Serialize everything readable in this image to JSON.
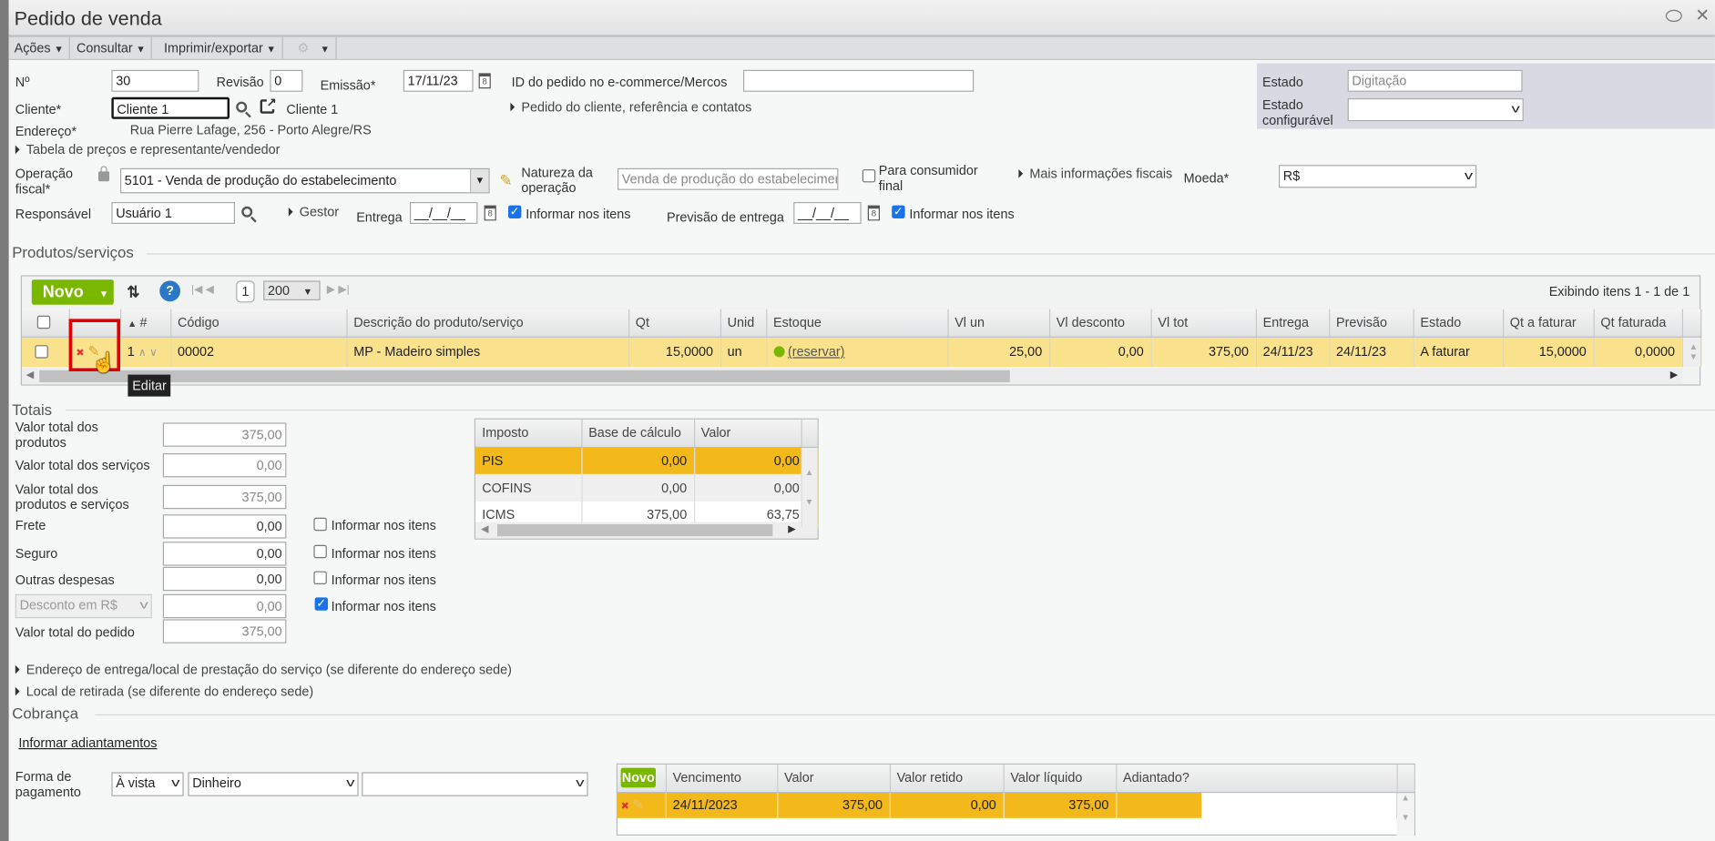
{
  "window": {
    "title": "Pedido de venda"
  },
  "toolbar": {
    "acoes": "Ações",
    "consultar": "Consultar",
    "imprimir": "Imprimir/exportar"
  },
  "header": {
    "numero_label": "Nº",
    "numero": "30",
    "revisao_label": "Revisão",
    "revisao": "0",
    "emissao_label": "Emissão*",
    "emissao": "17/11/23",
    "id_ecommerce_label": "ID do pedido no e-commerce/Mercos",
    "id_ecommerce": "",
    "cliente_label": "Cliente*",
    "cliente": "Cliente 1",
    "cliente_link": "Cliente 1",
    "pedido_cliente_expander": "Pedido do cliente, referência e contatos",
    "endereco_label": "Endereço*",
    "endereco": "Rua Pierre Lafage, 256 - Porto Alegre/RS",
    "tabela_precos_expander": "Tabela de preços e representante/vendedor",
    "operacao_label": "Operação fiscal*",
    "operacao": "5101 - Venda de produção do estabelecimento",
    "natureza_label": "Natureza da operação",
    "natureza": "Venda de produção do estabelecimento",
    "consumidor_final_label": "Para consumidor final",
    "mais_info_fiscais": "Mais informações fiscais",
    "moeda_label": "Moeda*",
    "moeda": "R$",
    "responsavel_label": "Responsável",
    "responsavel": "Usuário 1",
    "gestor_expander": "Gestor",
    "entrega_label": "Entrega",
    "entrega": "__/__/__",
    "entrega_informar": "Informar nos itens",
    "previsao_label": "Previsão de entrega",
    "previsao": "__/__/__",
    "previsao_informar": "Informar nos itens",
    "estado_label": "Estado",
    "estado": "Digitação",
    "estado_config_label": "Estado configurável",
    "estado_config": ""
  },
  "produtos": {
    "section_title": "Produtos/serviços",
    "novo": "Novo",
    "page": "1",
    "page_size": "200",
    "paging_info": "Exibindo itens 1 - 1 de 1",
    "columns": [
      "#",
      "Código",
      "Descrição do produto/serviço",
      "Qt",
      "Unid",
      "Estoque",
      "Vl un",
      "Vl desconto",
      "Vl tot",
      "Entrega",
      "Previsão",
      "Estado",
      "Qt a faturar",
      "Qt faturada"
    ],
    "rows": [
      {
        "n": "1",
        "codigo": "00002",
        "descricao": "MP - Madeiro simples",
        "qt": "15,0000",
        "unid": "un",
        "estoque": "(reservar)",
        "vl_un": "25,00",
        "vl_desc": "0,00",
        "vl_tot": "375,00",
        "entrega": "24/11/23",
        "previsao": "24/11/23",
        "estado": "A faturar",
        "qt_a_faturar": "15,0000",
        "qt_faturada": "0,0000"
      }
    ],
    "tooltip": "Editar"
  },
  "totais": {
    "section_title": "Totais",
    "fields": [
      {
        "label": "Valor total dos produtos",
        "value": "375,00"
      },
      {
        "label": "Valor total dos serviços",
        "value": "0,00"
      },
      {
        "label": "Valor total dos produtos e serviços",
        "value": "375,00"
      },
      {
        "label": "Frete",
        "value": "0,00",
        "informar": "Informar nos itens",
        "checked": false
      },
      {
        "label": "Seguro",
        "value": "0,00",
        "informar": "Informar nos itens",
        "checked": false
      },
      {
        "label": "Outras despesas",
        "value": "0,00",
        "informar": "Informar nos itens",
        "checked": false
      },
      {
        "label": "Desconto em R$",
        "value": "0,00",
        "informar": "Informar nos itens",
        "checked": true
      },
      {
        "label": "Valor total do pedido",
        "value": "375,00"
      }
    ],
    "impostos": {
      "columns": [
        "Imposto",
        "Base de cálculo",
        "Valor"
      ],
      "rows": [
        {
          "imposto": "PIS",
          "base": "0,00",
          "valor": "0,00"
        },
        {
          "imposto": "COFINS",
          "base": "0,00",
          "valor": "0,00"
        },
        {
          "imposto": "ICMS",
          "base": "375,00",
          "valor": "63,75"
        }
      ]
    }
  },
  "endereco_entrega_expander": "Endereço de entrega/local de prestação do serviço (se diferente do endereço sede)",
  "local_retirada_expander": "Local de retirada (se diferente do endereço sede)",
  "cobranca": {
    "section_title": "Cobrança",
    "adiantamentos_link": "Informar adiantamentos",
    "forma_label": "Forma de pagamento",
    "condicao": "À vista",
    "meio": "Dinheiro",
    "conta": "",
    "novo": "Novo",
    "columns": [
      "Vencimento",
      "Valor",
      "Valor retido",
      "Valor líquido",
      "Adiantado?"
    ],
    "rows": [
      {
        "vencimento": "24/11/2023",
        "valor": "375,00",
        "retido": "0,00",
        "liquido": "375,00",
        "adiantado": ""
      }
    ]
  },
  "colors": {
    "accent_green": "#7ab800",
    "row_selected": "#fae28c",
    "row_orange": "#f3b81a",
    "highlight_red": "#e00000"
  }
}
